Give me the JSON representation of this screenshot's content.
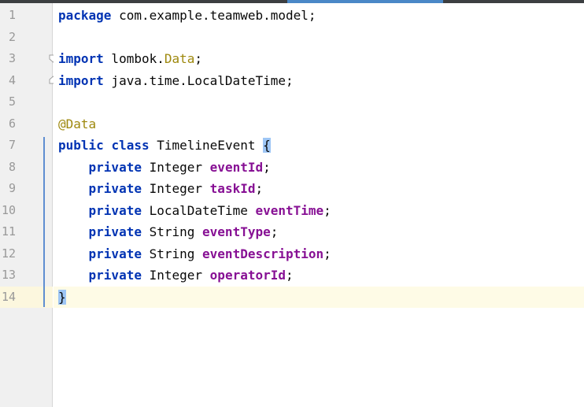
{
  "line_numbers": [
    "1",
    "2",
    "3",
    "4",
    "5",
    "6",
    "7",
    "8",
    "9",
    "10",
    "11",
    "12",
    "13",
    "14"
  ],
  "code": {
    "line1": {
      "kw": "package",
      "rest": " com.example.teamweb.model;"
    },
    "line3": {
      "kw": "import",
      "pre": " lombok.",
      "ann": "Data",
      "post": ";"
    },
    "line4": {
      "kw": "import",
      "rest": " java.time.LocalDateTime;"
    },
    "line6": {
      "ann": "@Data"
    },
    "line7": {
      "kw1": "public",
      "kw2": "class",
      "name": " TimelineEvent ",
      "brace": "{"
    },
    "fields": [
      {
        "kw": "private",
        "type": " Integer ",
        "name": "eventId",
        "semi": ";"
      },
      {
        "kw": "private",
        "type": " Integer ",
        "name": "taskId",
        "semi": ";"
      },
      {
        "kw": "private",
        "type": " LocalDateTime ",
        "name": "eventTime",
        "semi": ";"
      },
      {
        "kw": "private",
        "type": " String ",
        "name": "eventType",
        "semi": ";"
      },
      {
        "kw": "private",
        "type": " String ",
        "name": "eventDescription",
        "semi": ";"
      },
      {
        "kw": "private",
        "type": " Integer ",
        "name": "operatorId",
        "semi": ";"
      }
    ],
    "line14": {
      "brace": "}"
    }
  },
  "colors": {
    "keyword": "#0033b3",
    "annotation": "#9e880d",
    "field": "#871094",
    "caret_row": "#fefbe6",
    "brace_highlight": "#9ec6f5"
  }
}
